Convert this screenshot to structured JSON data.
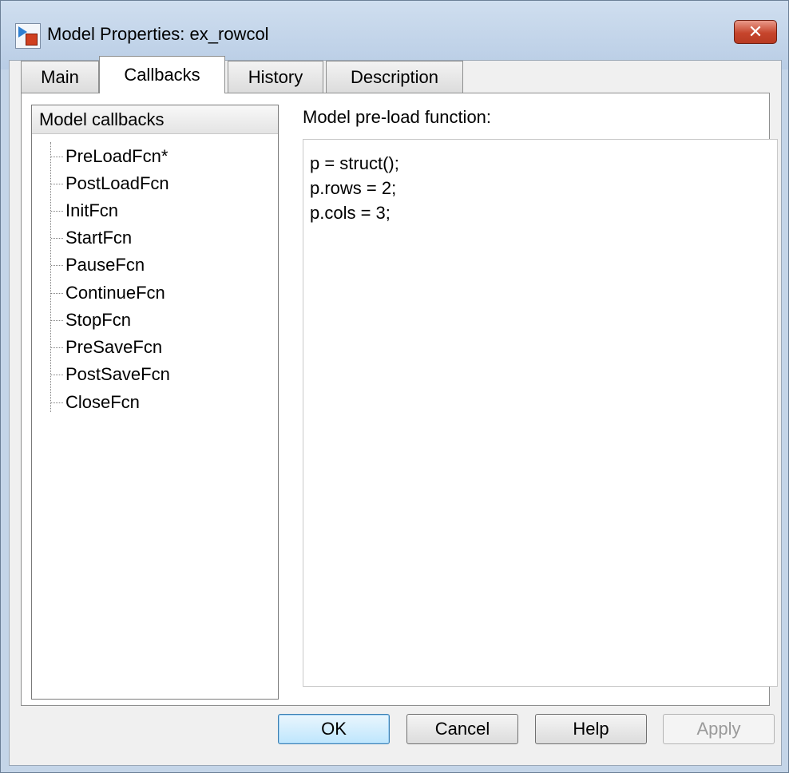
{
  "window": {
    "title": "Model Properties: ex_rowcol",
    "close_glyph": "✕",
    "app_icon": "simulink-model-icon",
    "close_icon": "close-icon"
  },
  "tabs": [
    {
      "label": "Main",
      "active": false
    },
    {
      "label": "Callbacks",
      "active": true
    },
    {
      "label": "History",
      "active": false
    },
    {
      "label": "Description",
      "active": false
    }
  ],
  "callbacks_tree": {
    "header": "Model callbacks",
    "items": [
      "PreLoadFcn*",
      "PostLoadFcn",
      "InitFcn",
      "StartFcn",
      "PauseFcn",
      "ContinueFcn",
      "StopFcn",
      "PreSaveFcn",
      "PostSaveFcn",
      "CloseFcn"
    ]
  },
  "editor": {
    "label": "Model pre-load function:",
    "code": "p = struct();\np.rows = 2;\np.cols = 3;"
  },
  "buttons": {
    "ok": "OK",
    "cancel": "Cancel",
    "help": "Help",
    "apply": "Apply",
    "apply_enabled": false
  },
  "colors": {
    "close_button": "#c6452c",
    "default_button_border": "#3c7fb1",
    "titlebar": "#b9cde5"
  }
}
